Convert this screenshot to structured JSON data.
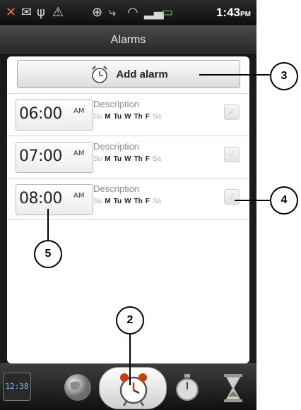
{
  "status_bar": {
    "time": "1:43",
    "ampm": "PM"
  },
  "title_bar": {
    "title": "Alarms"
  },
  "add_alarm": {
    "label": "Add alarm"
  },
  "alarms": [
    {
      "time": "06:00",
      "ampm": "AM",
      "description": "Description",
      "days": [
        "Su",
        "M",
        "Tu",
        "W",
        "Th",
        "F",
        "Sa"
      ],
      "active_days": [
        false,
        true,
        true,
        true,
        true,
        true,
        false
      ]
    },
    {
      "time": "07:00",
      "ampm": "AM",
      "description": "Description",
      "days": [
        "Su",
        "M",
        "Tu",
        "W",
        "Th",
        "F",
        "Sa"
      ],
      "active_days": [
        false,
        true,
        true,
        true,
        true,
        true,
        false
      ]
    },
    {
      "time": "08:00",
      "ampm": "AM",
      "description": "Description",
      "days": [
        "Su",
        "M",
        "Tu",
        "W",
        "Th",
        "F",
        "Sa"
      ],
      "active_days": [
        false,
        true,
        true,
        true,
        true,
        true,
        false
      ]
    }
  ],
  "tab_bar": {
    "clock_label": "12:38"
  },
  "callouts": {
    "c2": "2",
    "c3": "3",
    "c4": "4",
    "c5": "5"
  },
  "colors": {
    "accent_blue": "#7db0ff"
  }
}
